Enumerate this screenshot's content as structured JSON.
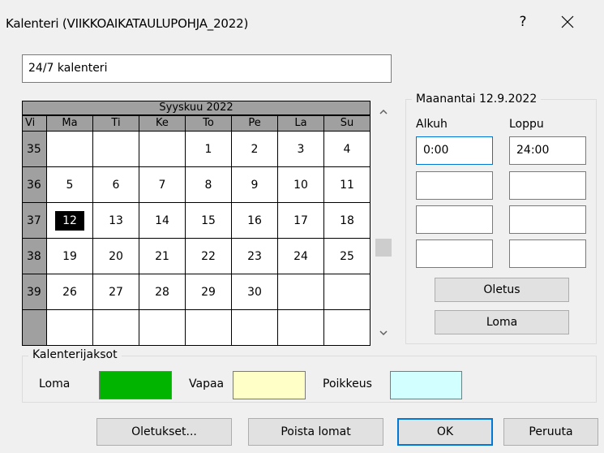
{
  "window": {
    "title": "Kalenteri (VIIKKOAIKATAULUPOHJA_2022)",
    "help_label": "?",
    "close_label": "✕"
  },
  "calendar_name": {
    "value": "24/7 kalenteri"
  },
  "calendar": {
    "month_title": "Syyskuu 2022",
    "headers": [
      "Vi",
      "Ma",
      "Ti",
      "Ke",
      "To",
      "Pe",
      "La",
      "Su"
    ],
    "weeks": [
      {
        "week": "35",
        "days": [
          "",
          "",
          "",
          "1",
          "2",
          "3",
          "4"
        ]
      },
      {
        "week": "36",
        "days": [
          "5",
          "6",
          "7",
          "8",
          "9",
          "10",
          "11"
        ]
      },
      {
        "week": "37",
        "days": [
          "12",
          "13",
          "14",
          "15",
          "16",
          "17",
          "18"
        ]
      },
      {
        "week": "38",
        "days": [
          "19",
          "20",
          "21",
          "22",
          "23",
          "24",
          "25"
        ]
      },
      {
        "week": "39",
        "days": [
          "26",
          "27",
          "28",
          "29",
          "30",
          "",
          ""
        ]
      },
      {
        "week": "",
        "days": [
          "",
          "",
          "",
          "",
          "",
          "",
          ""
        ]
      }
    ],
    "selected_day": "12"
  },
  "day_panel": {
    "legend": "Maanantai 12.9.2022",
    "start_label": "Alkuh",
    "end_label": "Loppu",
    "rows": [
      {
        "start": "0:00",
        "end": "24:00"
      },
      {
        "start": "",
        "end": ""
      },
      {
        "start": "",
        "end": ""
      },
      {
        "start": "",
        "end": ""
      }
    ],
    "default_button": "Oletus",
    "holiday_button": "Loma"
  },
  "periods": {
    "legend": "Kalenterijaksot",
    "items": [
      {
        "label": "Loma",
        "color": "#00b400"
      },
      {
        "label": "Vapaa",
        "color": "#ffffc8"
      },
      {
        "label": "Poikkeus",
        "color": "#d2ffff"
      }
    ]
  },
  "footer": {
    "defaults_button": "Oletukset...",
    "remove_holidays_button": "Poista lomat",
    "ok_button": "OK",
    "cancel_button": "Peruuta"
  }
}
